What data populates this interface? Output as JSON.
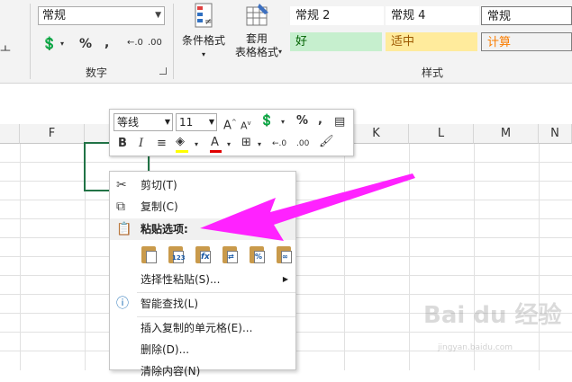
{
  "ribbon": {
    "number_format_value": "常规",
    "number_group_label": "数字",
    "styles_group_label": "样式",
    "conditional_format_label_1": "条件格式",
    "format_as_table_label_1": "套用",
    "format_as_table_label_2": "表格格式",
    "styles": {
      "normal2": "常规 2",
      "normal4": "常规 4",
      "normal": "常规",
      "good": "好",
      "neutral": "适中",
      "calculation": "计算"
    },
    "colors": {
      "good_bg": "#c6efce",
      "good_fg": "#006100",
      "neutral_bg": "#ffeb9c",
      "neutral_fg": "#9c5700",
      "calc_bg": "#f2f2f2",
      "calc_fg": "#fa7d00"
    }
  },
  "columns": [
    "F",
    "",
    "",
    "",
    "K",
    "L",
    "M",
    "N"
  ],
  "mini_toolbar": {
    "font_name": "等线",
    "font_size": "11",
    "bold": "B",
    "italic": "I",
    "percent": "%",
    "comma": ","
  },
  "context_menu": {
    "items": [
      {
        "label": "剪切(T)",
        "icon": "scissors-icon"
      },
      {
        "label": "复制(C)",
        "icon": "copy-icon"
      },
      {
        "label": "粘贴选项:",
        "icon": "clipboard-icon"
      },
      {
        "label": "选择性粘贴(S)...",
        "icon": ""
      },
      {
        "label": "智能查找(L)",
        "icon": "smart-lookup-icon"
      },
      {
        "label": "插入复制的单元格(E)...",
        "icon": ""
      },
      {
        "label": "删除(D)...",
        "icon": ""
      },
      {
        "label": "清除内容(N)",
        "icon": ""
      }
    ],
    "paste_options": [
      "paste",
      "123",
      "fx",
      "paste-formatting",
      "%",
      "link"
    ]
  },
  "annotation_color": "#ff22ff",
  "watermark": "Bai du 经验",
  "watermark_url": "jingyan.baidu.com"
}
